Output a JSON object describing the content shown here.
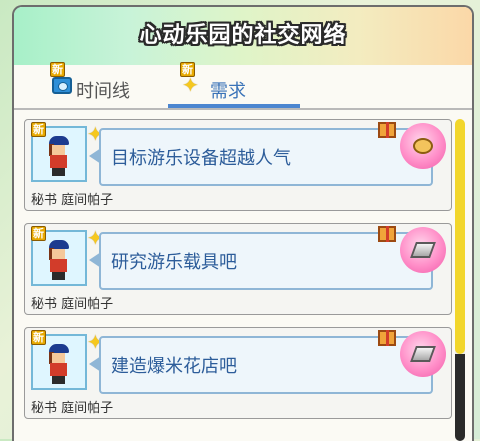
{
  "window": {
    "title": "心动乐园的社交网络"
  },
  "tabs": [
    {
      "label": "时间线",
      "icon": "camera-icon",
      "badge": "新"
    },
    {
      "label": "需求",
      "icon": "sparkle-icon",
      "badge": "新",
      "active": true
    }
  ],
  "cards": [
    {
      "badge": "新",
      "request": "目标游乐设备超越人气",
      "name": "秘书 庭间帕子",
      "reward_icon": "food-icon"
    },
    {
      "badge": "新",
      "request": "研究游乐载具吧",
      "name": "秘书 庭间帕子",
      "reward_icon": "metal-icon"
    },
    {
      "badge": "新",
      "request": "建造爆米花店吧",
      "name": "秘书 庭间帕子",
      "reward_icon": "metal-icon"
    }
  ],
  "colors": {
    "accent": "#4c86d0",
    "scroll_thumb": "#f2d62b",
    "reward_bg": "#ff8ec8"
  }
}
